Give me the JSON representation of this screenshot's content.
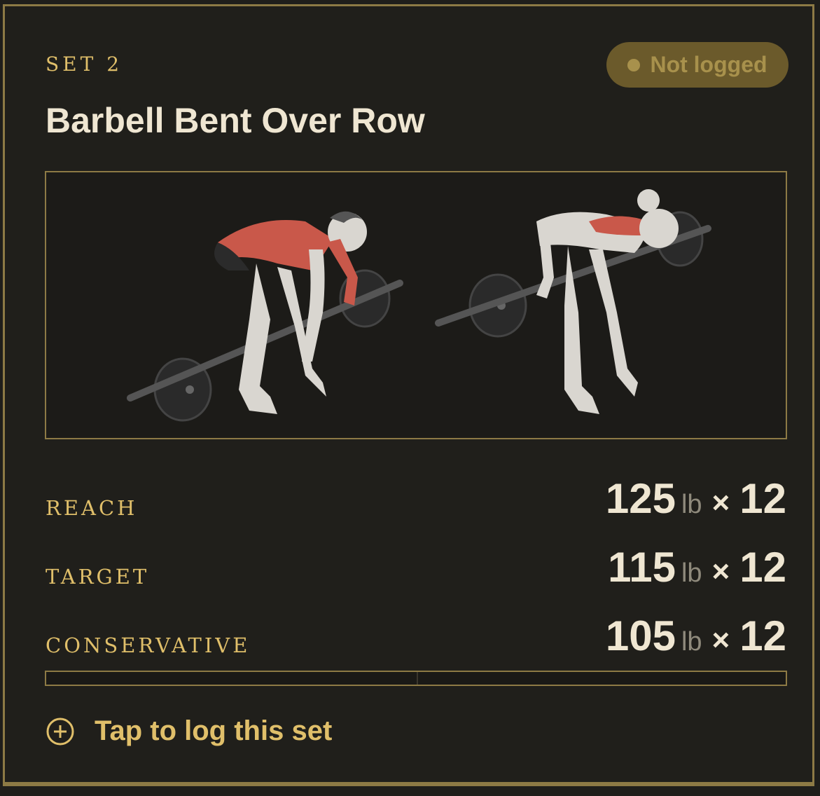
{
  "set": {
    "label": "SET 2",
    "status": "Not logged"
  },
  "exercise": {
    "name": "Barbell Bent Over Row",
    "illustration_alt": ""
  },
  "targets": [
    {
      "label": "REACH",
      "weight": "125",
      "unit": "lb",
      "sep": "×",
      "reps": "12"
    },
    {
      "label": "TARGET",
      "weight": "115",
      "unit": "lb",
      "sep": "×",
      "reps": "12"
    },
    {
      "label": "CONSERVATIVE",
      "weight": "105",
      "unit": "lb",
      "sep": "×",
      "reps": "12"
    }
  ],
  "progress": {
    "value": 0
  },
  "action": {
    "label": "Tap to log this set",
    "icon": "plus-circle-icon"
  },
  "colors": {
    "accent": "#e0bf6a",
    "border": "#8d7a45",
    "background": "#201f1b",
    "pill": "#6b5a2b"
  }
}
